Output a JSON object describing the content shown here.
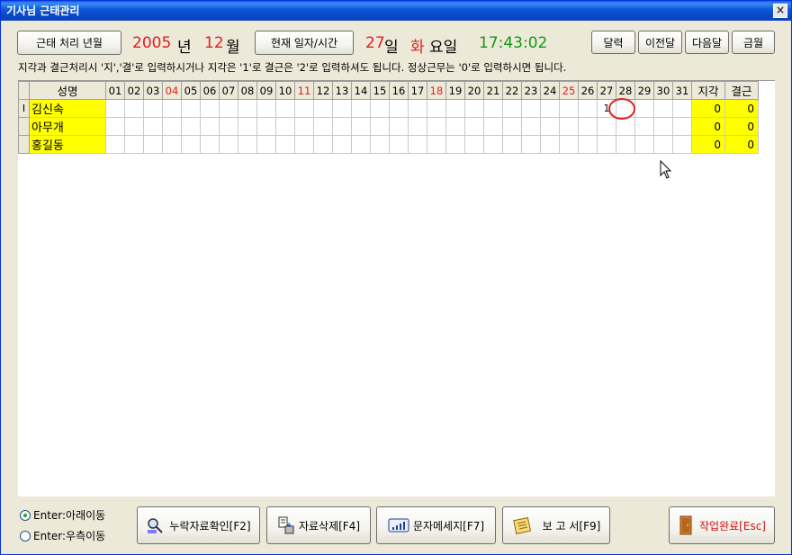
{
  "window": {
    "title": "기사님 근태관리",
    "close_glyph": "×"
  },
  "header": {
    "period_button": "근태 처리 년월",
    "year": "2005",
    "year_unit": "년",
    "month": "12",
    "month_unit": "월",
    "now_button": "현재 일자/시간",
    "day": "27",
    "day_unit": "일",
    "weekday": "화",
    "weekday_unit": "요일",
    "time": "17:43:02"
  },
  "nav": {
    "calendar": "달력",
    "prev": "이전달",
    "next": "다음달",
    "current": "금월"
  },
  "info_text": "지각과 결근처리시 '지','결'로 입력하시거나 지각은 '1'로 결근은 '2'로 입력하셔도 됩니다.  정상근무는 '0'로 입력하시면 됩니다.",
  "grid": {
    "name_header": "성명",
    "days": [
      "01",
      "02",
      "03",
      "04",
      "05",
      "06",
      "07",
      "08",
      "09",
      "10",
      "11",
      "12",
      "13",
      "14",
      "15",
      "16",
      "17",
      "18",
      "19",
      "20",
      "21",
      "22",
      "23",
      "24",
      "25",
      "26",
      "27",
      "28",
      "29",
      "30",
      "31"
    ],
    "red_days": [
      "04",
      "11",
      "18",
      "25"
    ],
    "late_header": "지각",
    "absent_header": "결근",
    "row_indicator": "I",
    "rows": [
      {
        "name": "김신속",
        "marks": {
          "27": "1"
        },
        "late": "0",
        "absent": "0"
      },
      {
        "name": "아무개",
        "marks": {},
        "late": "0",
        "absent": "0"
      },
      {
        "name": "홍길동",
        "marks": {},
        "late": "0",
        "absent": "0"
      }
    ]
  },
  "options": {
    "enter_down": "Enter:아래이동",
    "enter_right": "Enter:우측이동",
    "selected": "enter_down"
  },
  "footer": {
    "missing_check": "누락자료확인[F2]",
    "delete": "자료삭제[F4]",
    "sms": "문자메세지[F7]",
    "report": "보 고 서[F9]",
    "done": "작업완료[Esc]"
  },
  "colors": {
    "accent_red": "#e02020",
    "time_green": "#139813",
    "name_cell_yellow": "#ffff00",
    "title_blue": "#0846c6"
  }
}
